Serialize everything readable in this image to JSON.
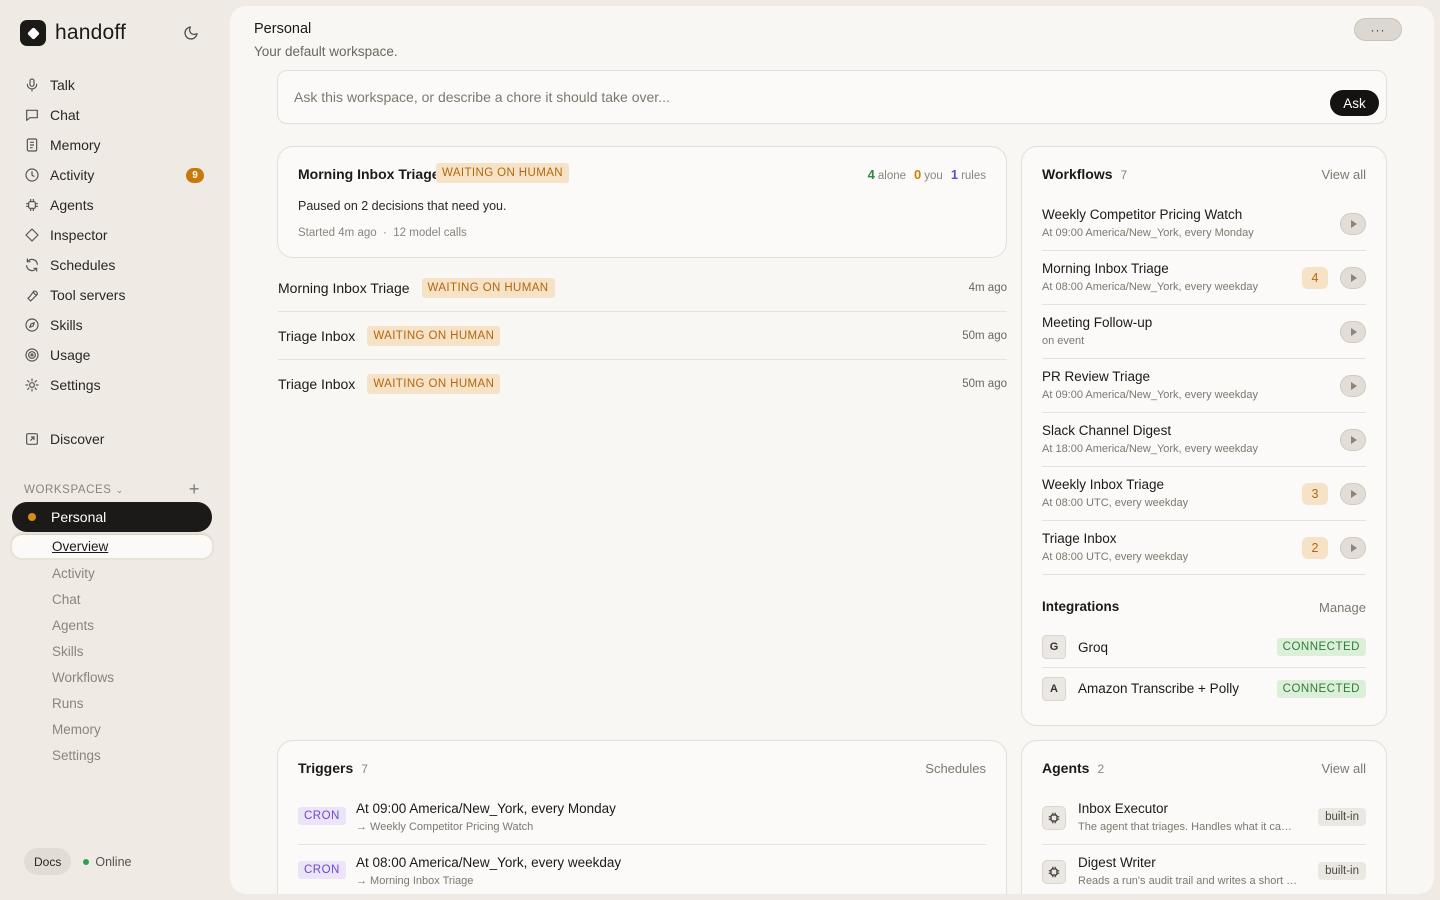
{
  "brand": {
    "name": "handoff"
  },
  "nav": [
    {
      "label": "Talk",
      "icon": "mic-icon"
    },
    {
      "label": "Chat",
      "icon": "chat-icon"
    },
    {
      "label": "Memory",
      "icon": "memory-icon"
    },
    {
      "label": "Activity",
      "icon": "clock-icon",
      "badge": "9"
    },
    {
      "label": "Agents",
      "icon": "agent-icon"
    },
    {
      "label": "Inspector",
      "icon": "diamond-icon"
    },
    {
      "label": "Schedules",
      "icon": "refresh-icon"
    },
    {
      "label": "Tool servers",
      "icon": "wrench-icon"
    },
    {
      "label": "Skills",
      "icon": "compass-icon"
    },
    {
      "label": "Usage",
      "icon": "target-icon"
    },
    {
      "label": "Settings",
      "icon": "sun-gear-icon"
    }
  ],
  "discover": {
    "label": "Discover",
    "icon": "external-link-icon"
  },
  "workspaces": {
    "header": "WORKSPACES",
    "current": "Personal",
    "sub_items": [
      "Overview",
      "Activity",
      "Chat",
      "Agents",
      "Skills",
      "Workflows",
      "Runs",
      "Memory",
      "Settings"
    ]
  },
  "footer": {
    "docs": "Docs",
    "status": "Online"
  },
  "header": {
    "title": "Personal",
    "description": "Your default workspace.",
    "more": "···"
  },
  "ask": {
    "placeholder": "Ask this workspace, or describe a chore it should take over...",
    "button": "Ask"
  },
  "featured_run": {
    "title": "Morning Inbox Triage",
    "status": "WAITING ON HUMAN",
    "stats": [
      {
        "value": "4",
        "label": "alone"
      },
      {
        "value": "0",
        "label": "you"
      },
      {
        "value": "1",
        "label": "rules"
      }
    ],
    "message": "Paused on 2 decisions that need you.",
    "started": "Started 4m ago",
    "calls": "12 model calls"
  },
  "runs": [
    {
      "name": "Morning Inbox Triage",
      "status": "WAITING ON HUMAN",
      "time": "4m ago"
    },
    {
      "name": "Triage Inbox",
      "status": "WAITING ON HUMAN",
      "time": "50m ago"
    },
    {
      "name": "Triage Inbox",
      "status": "WAITING ON HUMAN",
      "time": "50m ago"
    }
  ],
  "workflows": {
    "title": "Workflows",
    "count": "7",
    "link": "View all",
    "items": [
      {
        "name": "Weekly Competitor Pricing Watch",
        "schedule": "At 09:00 America/New_York, every Monday",
        "pending": ""
      },
      {
        "name": "Morning Inbox Triage",
        "schedule": "At 08:00 America/New_York, every weekday",
        "pending": "4"
      },
      {
        "name": "Meeting Follow-up",
        "schedule": "on event",
        "pending": ""
      },
      {
        "name": "PR Review Triage",
        "schedule": "At 09:00 America/New_York, every weekday",
        "pending": ""
      },
      {
        "name": "Slack Channel Digest",
        "schedule": "At 18:00 America/New_York, every weekday",
        "pending": ""
      },
      {
        "name": "Weekly Inbox Triage",
        "schedule": "At 08:00 UTC, every weekday",
        "pending": "3"
      },
      {
        "name": "Triage Inbox",
        "schedule": "At 08:00 UTC, every weekday",
        "pending": "2"
      }
    ]
  },
  "integrations": {
    "title": "Integrations",
    "link": "Manage",
    "items": [
      {
        "initial": "G",
        "name": "Groq",
        "status": "CONNECTED"
      },
      {
        "initial": "A",
        "name": "Amazon Transcribe + Polly",
        "status": "CONNECTED"
      }
    ]
  },
  "triggers": {
    "title": "Triggers",
    "count": "7",
    "link": "Schedules",
    "items": [
      {
        "type": "CRON",
        "schedule": "At 09:00 America/New_York, every Monday",
        "target": "→ Weekly Competitor Pricing Watch"
      },
      {
        "type": "CRON",
        "schedule": "At 08:00 America/New_York, every weekday",
        "target": "→ Morning Inbox Triage"
      }
    ]
  },
  "agents": {
    "title": "Agents",
    "count": "2",
    "link": "View all",
    "items": [
      {
        "name": "Inbox Executor",
        "description": "The agent that triages. Handles what it can on its own",
        "tag": "built-in"
      },
      {
        "name": "Digest Writer",
        "description": "Reads a run's audit trail and writes a short summary",
        "tag": "built-in"
      }
    ]
  }
}
